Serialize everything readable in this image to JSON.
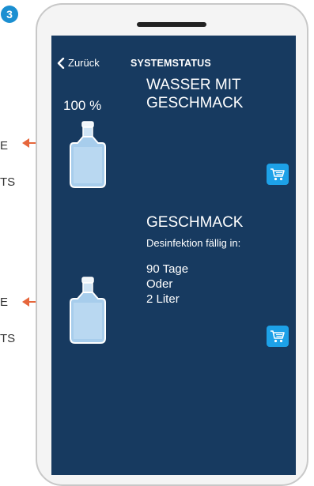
{
  "step_badge": "3",
  "edge_text": [
    "E",
    "TS",
    "E",
    "TS"
  ],
  "nav": {
    "back_label": "Zurück",
    "title": "SYSTEMSTATUS"
  },
  "items": [
    {
      "level_label": "100 %",
      "title_lines": [
        "WASSER MIT",
        "GESCHMACK"
      ],
      "icon": "bottle-icon",
      "action_icon": "cart-icon"
    },
    {
      "title": "GESCHMACK",
      "subtitle": "Desinfektion fällig in:",
      "details": [
        "90 Tage",
        "Oder",
        "2 Liter"
      ],
      "icon": "bottle-icon",
      "action_icon": "cart-icon"
    }
  ],
  "colors": {
    "screen_bg": "#173a60",
    "accent": "#1da1e8",
    "badge": "#1b8fd1",
    "pointer": "#e6663b"
  }
}
